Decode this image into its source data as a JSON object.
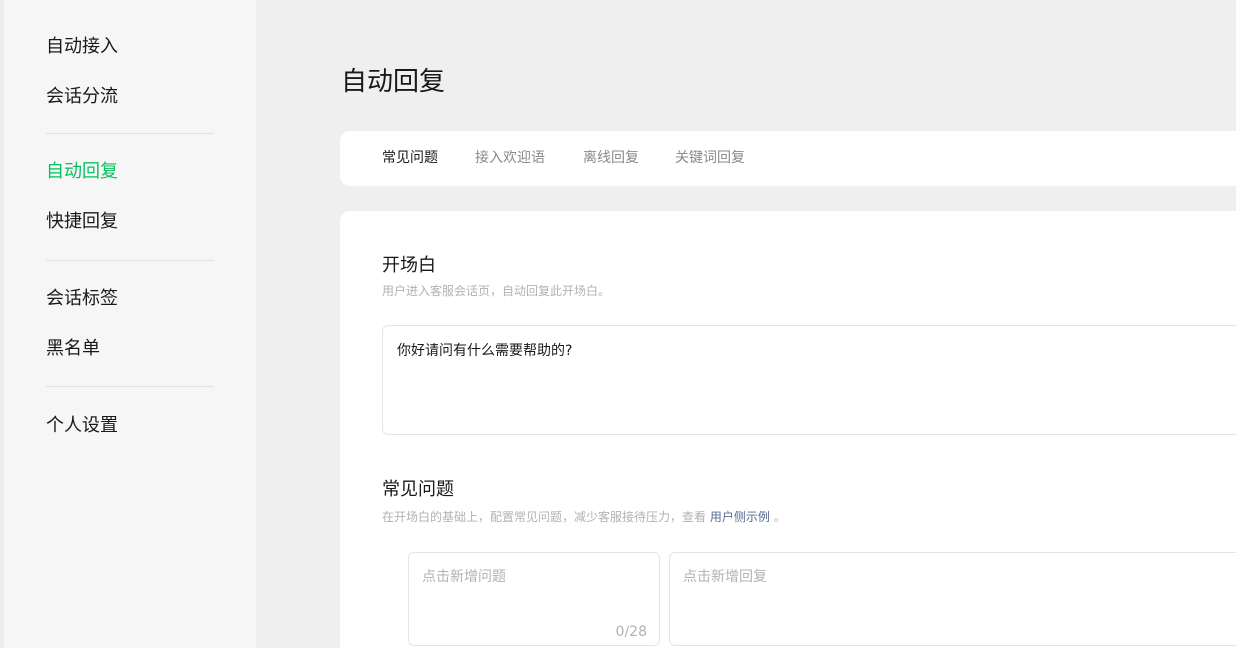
{
  "sidebar": {
    "items": [
      {
        "label": "自动接入"
      },
      {
        "label": "会话分流"
      },
      {
        "label": "自动回复",
        "active": true
      },
      {
        "label": "快捷回复"
      },
      {
        "label": "会话标签"
      },
      {
        "label": "黑名单"
      },
      {
        "label": "个人设置"
      }
    ]
  },
  "main": {
    "title": "自动回复",
    "tabs": [
      {
        "label": "常见问题",
        "active": true
      },
      {
        "label": "接入欢迎语"
      },
      {
        "label": "离线回复"
      },
      {
        "label": "关键词回复"
      }
    ],
    "opening": {
      "title": "开场白",
      "desc": "用户进入客服会话页，自动回复此开场白。",
      "value": "你好请问有什么需要帮助的?"
    },
    "faq": {
      "title": "常见问题",
      "desc_prefix": "在开场白的基础上，配置常见问题，减少客服接待压力，查看",
      "desc_link": "用户侧示例",
      "desc_suffix": "。",
      "question_placeholder": "点击新增问题",
      "question_count": "0/28",
      "reply_placeholder": "点击新增回复"
    }
  },
  "colors": {
    "accent": "#07c160",
    "link": "#576b95"
  }
}
